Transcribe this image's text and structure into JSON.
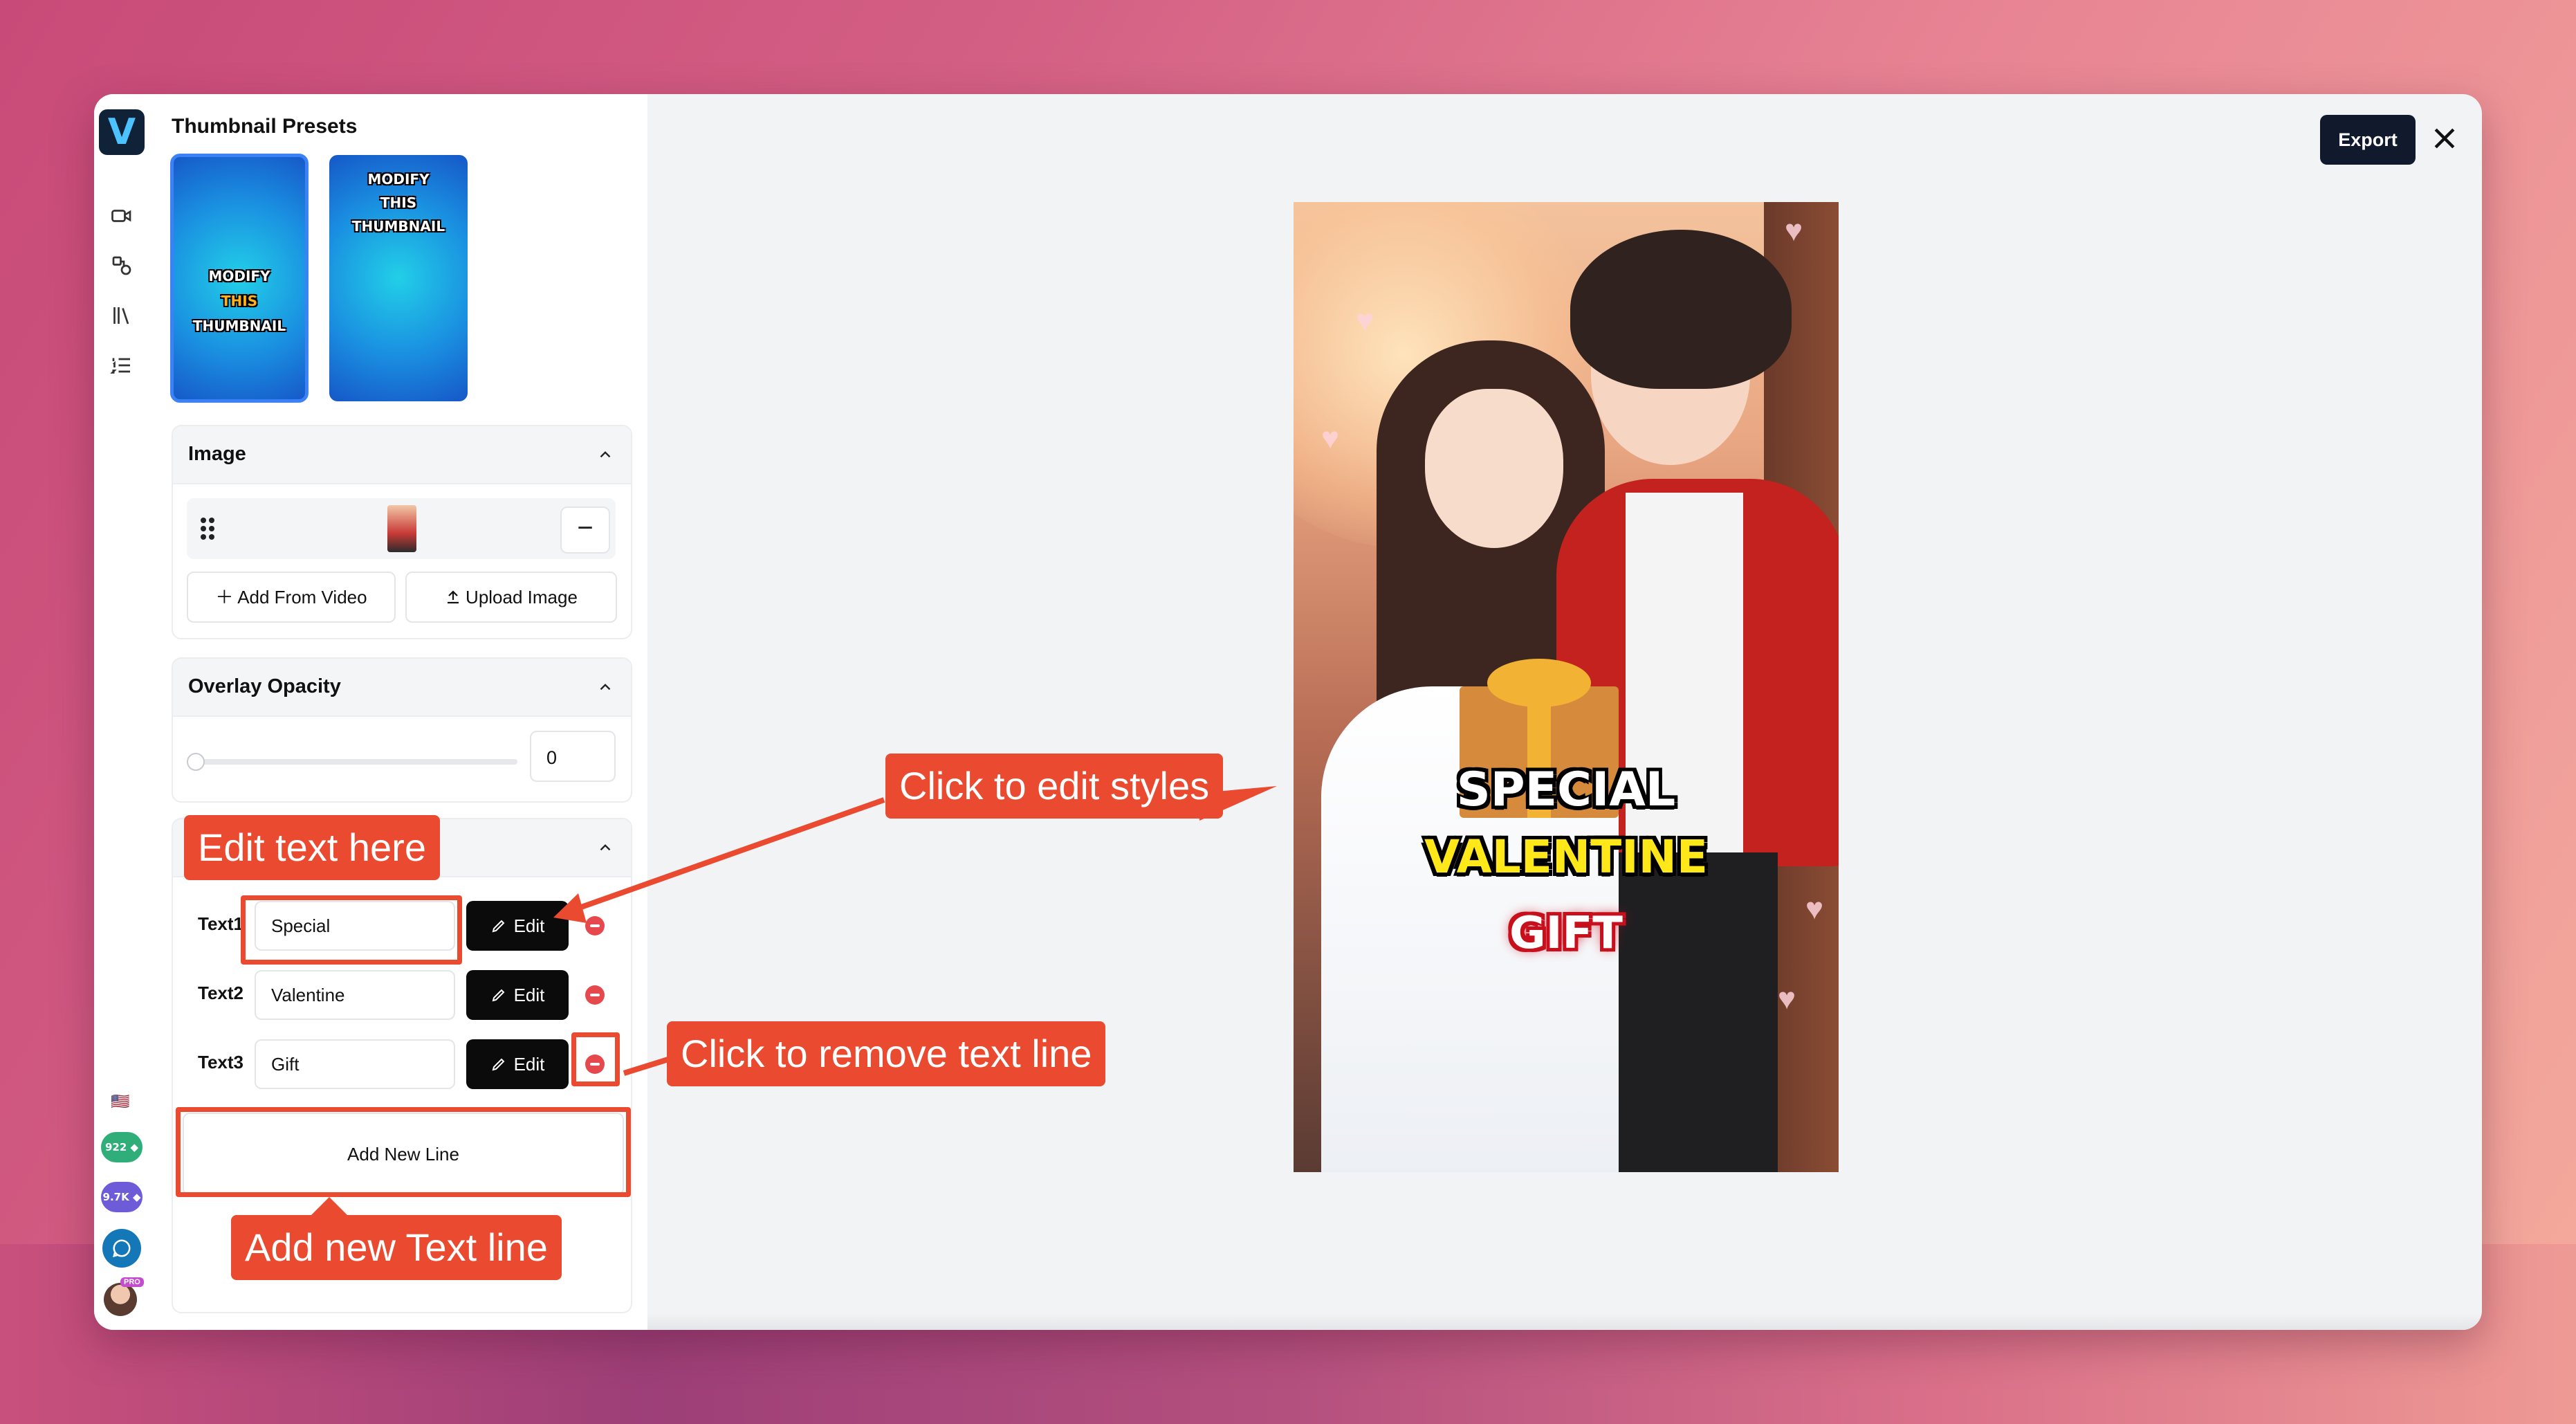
{
  "panel": {
    "title": "Thumbnail Presets",
    "presets": [
      {
        "line1": "MODIFY",
        "line2": "THIS",
        "line3": "THUMBNAIL",
        "selected": true
      },
      {
        "line1": "MODIFY",
        "line2": "THIS",
        "line3": "THUMBNAIL",
        "selected": false
      }
    ]
  },
  "image_section": {
    "title": "Image",
    "remove_symbol": "−",
    "add_from_video": "Add From Video",
    "upload_image": "Upload Image"
  },
  "overlay_section": {
    "title": "Overlay Opacity",
    "value": "0"
  },
  "text_section": {
    "rows": [
      {
        "label": "Text1",
        "value": "Special",
        "edit": "Edit"
      },
      {
        "label": "Text2",
        "value": "Valentine",
        "edit": "Edit"
      },
      {
        "label": "Text3",
        "value": "Gift",
        "edit": "Edit"
      }
    ],
    "add_line": "Add New Line"
  },
  "rail": {
    "credits_1": "922",
    "credits_2": "9.7K",
    "flag": "🇺🇸",
    "pro_badge": "PRO"
  },
  "toolbar": {
    "export": "Export"
  },
  "thumbnail": {
    "line1": "SPECIAL",
    "line2": "VALENTINE",
    "line3": "GIFT"
  },
  "annotations": {
    "edit_text": "Edit text here",
    "edit_styles": "Click to edit styles",
    "remove_line": "Click to remove text line",
    "add_line": "Add new Text line"
  },
  "colors": {
    "accent": "#ea4a2f",
    "selected_outline": "#3b82f6",
    "remove": "#e5484d",
    "credits_1": "#2fae7a",
    "credits_2": "#6d5bd8"
  }
}
